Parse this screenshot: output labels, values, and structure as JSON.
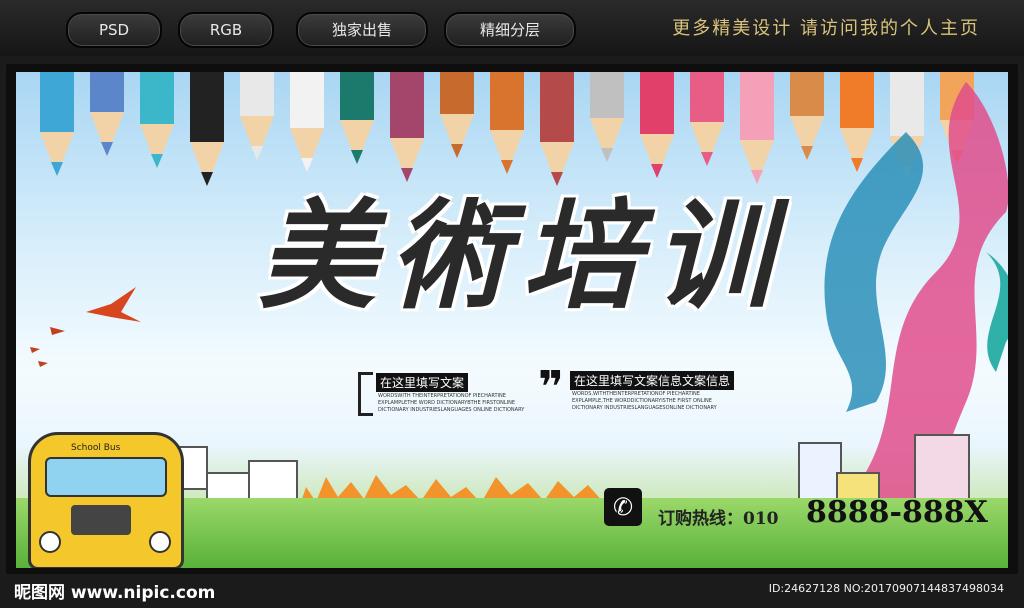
{
  "topbar": {
    "pills": [
      "PSD",
      "RGB",
      "独家出售",
      "精细分层"
    ],
    "promo": "更多精美设计 请访问我的个人主页"
  },
  "banner": {
    "title": "美術培训",
    "tag_left": "在这里填写文案",
    "tag_right": "在这里填写文案信息文案信息",
    "small_left": "WORDSWITH THEINTERPRETATIONOF PIECHARTINE EXPLAMPLETHE WORD DICTIONARYBTHE FIRSTONLINE DICTIONARY INDUSTRIESLANGUAGES ONLINE DICTIONARY",
    "small_right": "WORDS,WITHTHEINTERPRETATIONOF PIECHARTINE EXPLAMPLE,THE WORDDICTIONARYISTHE FIRST ONLINE DICTIONARY INDUSTRIESLANGUAGESONLINE DICTIONARY",
    "bus_label": "School Bus",
    "hotline_label": "订购热线：010",
    "hotline_number": "8888-888X"
  },
  "footer": {
    "logo": "昵图网 www.nipic.com",
    "id_text": "ID:24627128 NO:20170907144837498034"
  },
  "colors": {
    "pencils": [
      "#3fa7d6",
      "#5b86c9",
      "#3cb7c9",
      "#222",
      "#e8e8e8",
      "#f2f2f2",
      "#1b7a6b",
      "#a4456b",
      "#c76a2e",
      "#d9742f",
      "#b44a4a",
      "#c0c0c0",
      "#e0406a",
      "#e85d86",
      "#f4a0b8",
      "#d98b4a",
      "#f07c2a",
      "#e9e9e9",
      "#f2a45a"
    ]
  }
}
